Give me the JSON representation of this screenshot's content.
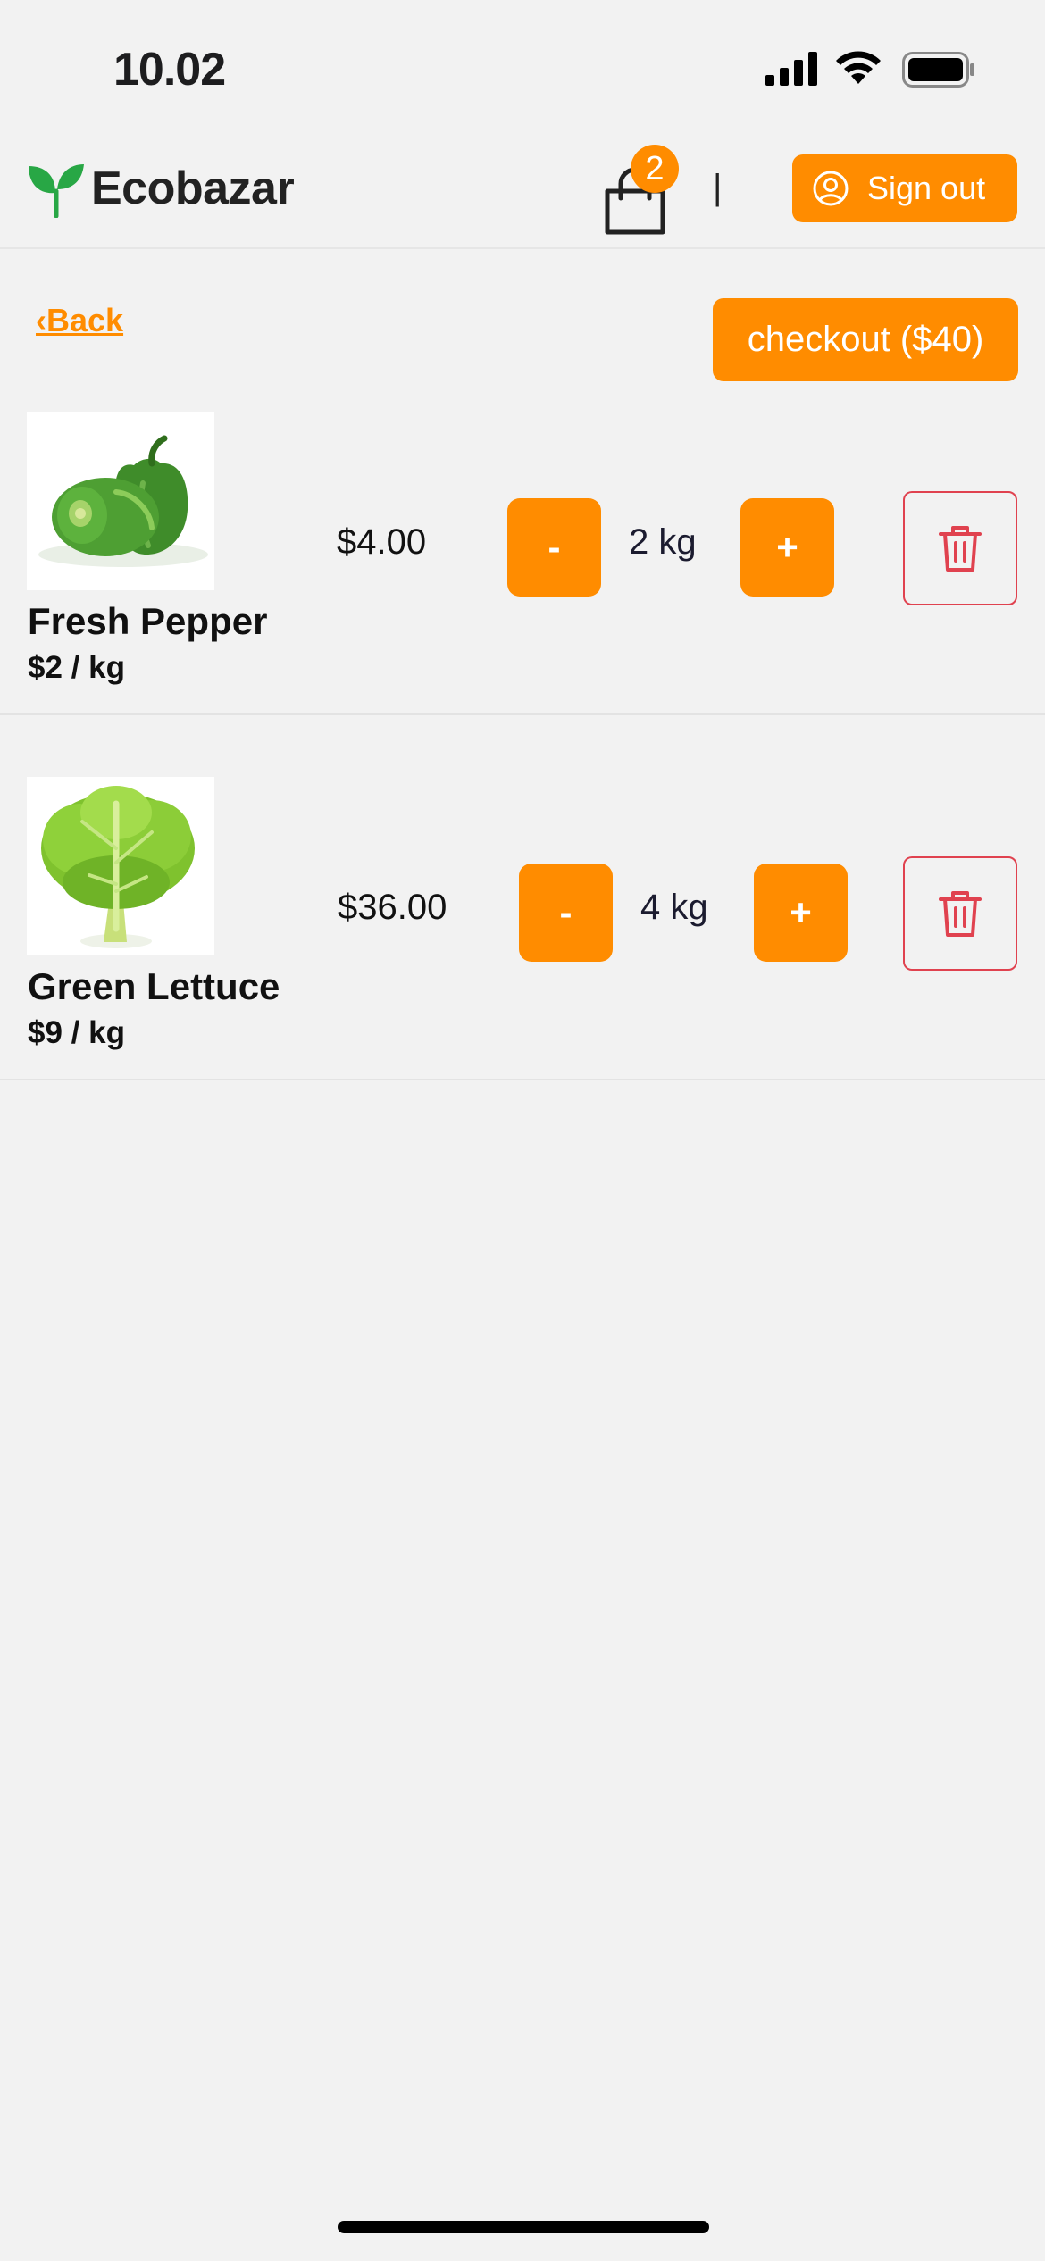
{
  "status": {
    "time": "10.02"
  },
  "header": {
    "brand": "Ecobazar",
    "cart_count": "2",
    "separator": "|",
    "signout_label": "Sign out"
  },
  "toolbar": {
    "back_label": "‹Back",
    "checkout_label": "checkout ($40)"
  },
  "cart_items": [
    {
      "name": "Fresh Pepper",
      "unit_price": "$2 / kg",
      "line_total": "$4.00",
      "quantity": "2 kg",
      "minus": "-",
      "plus": "+"
    },
    {
      "name": "Green Lettuce",
      "unit_price": "$9 / kg",
      "line_total": "$36.00",
      "quantity": "4 kg",
      "minus": "-",
      "plus": "+"
    }
  ],
  "colors": {
    "accent": "#ff8c00",
    "danger": "#e0424f",
    "brand_green": "#28a745",
    "background": "#f2f2f2"
  }
}
